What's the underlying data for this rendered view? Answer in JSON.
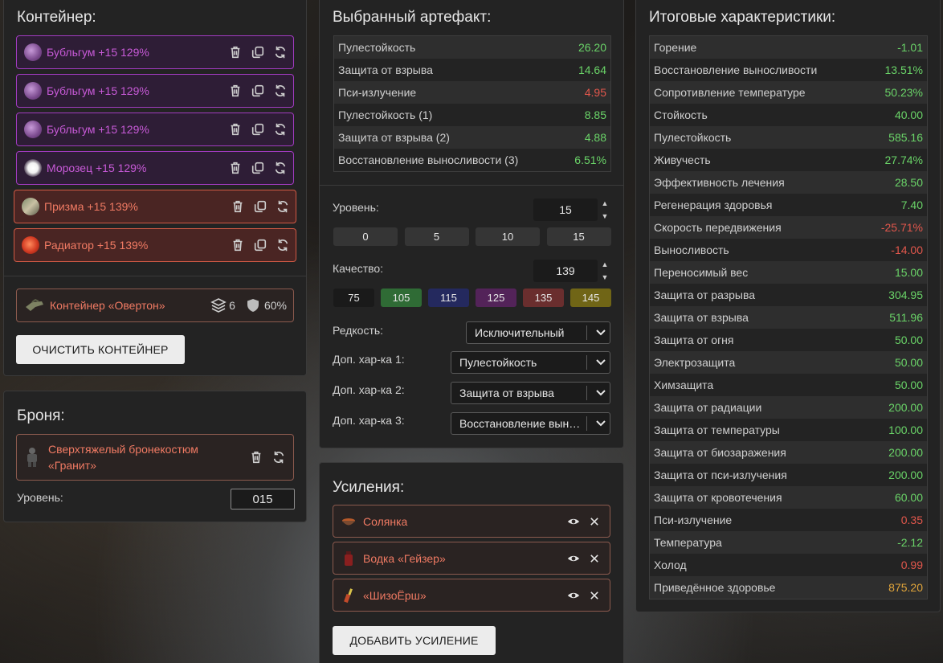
{
  "container_panel": {
    "title": "Контейнер:",
    "items": [
      {
        "name": "Бубльгум +15 129%",
        "tone": "purple",
        "icon": "bubblegum-artifact-icon"
      },
      {
        "name": "Бубльгум +15 129%",
        "tone": "purple",
        "icon": "bubblegum-artifact-icon"
      },
      {
        "name": "Бубльгум +15 129%",
        "tone": "purple",
        "icon": "bubblegum-artifact-icon"
      },
      {
        "name": "Морозец +15 129%",
        "tone": "purple",
        "icon": "frost-artifact-icon"
      },
      {
        "name": "Призма +15 139%",
        "tone": "red",
        "icon": "prism-artifact-icon"
      },
      {
        "name": "Радиатор +15 139%",
        "tone": "red",
        "icon": "radiator-artifact-icon"
      }
    ],
    "container": {
      "name": "Контейнер «Овертон»",
      "slots": "6",
      "protection": "60%"
    },
    "clear_button": "ОЧИСТИТЬ КОНТЕЙНЕР"
  },
  "armor_panel": {
    "title": "Броня:",
    "armor_name_line1": "Сверхтяжелый бронекостюм",
    "armor_name_line2": "«Гранит»",
    "level_label": "Уровень:",
    "level_value": "015"
  },
  "artifact_panel": {
    "title": "Выбранный артефакт:",
    "stats": [
      {
        "label": "Пулестойкость",
        "value": "26.20",
        "tone": "green"
      },
      {
        "label": "Защита от взрыва",
        "value": "14.64",
        "tone": "green"
      },
      {
        "label": "Пси-излучение",
        "value": "4.95",
        "tone": "red"
      },
      {
        "label": "Пулестойкость (1)",
        "value": "8.85",
        "tone": "green"
      },
      {
        "label": "Защита от взрыва (2)",
        "value": "4.88",
        "tone": "green"
      },
      {
        "label": "Восстановление выносливости (3)",
        "value": "6.51%",
        "tone": "green"
      }
    ],
    "level_label": "Уровень:",
    "level_value": "15",
    "level_presets": [
      "0",
      "5",
      "10",
      "15"
    ],
    "quality_label": "Качество:",
    "quality_value": "139",
    "quality_presets": [
      {
        "label": "75",
        "color": "#1a1a1a"
      },
      {
        "label": "105",
        "color": "#2f6b35"
      },
      {
        "label": "115",
        "color": "#24295e"
      },
      {
        "label": "125",
        "color": "#532359"
      },
      {
        "label": "135",
        "color": "#6a2e2e"
      },
      {
        "label": "145",
        "color": "#706516"
      }
    ],
    "rarity_label": "Редкость:",
    "rarity_value": "Исключительный",
    "extra1_label": "Доп. хар-ка 1:",
    "extra1_value": "Пулестойкость",
    "extra2_label": "Доп. хар-ка 2:",
    "extra2_value": "Защита от взрыва",
    "extra3_label": "Доп. хар-ка 3:",
    "extra3_value": "Восстановление выносливости"
  },
  "boosts_panel": {
    "title": "Усиления:",
    "items": [
      {
        "name": "Солянка",
        "icon": "solyanka-bowl-icon"
      },
      {
        "name": "Водка «Гейзер»",
        "icon": "vodka-bottle-icon"
      },
      {
        "name": "«ШизоЁрш»",
        "icon": "cocktail-bottle-icon"
      }
    ],
    "add_button": "ДОБАВИТЬ УСИЛЕНИЕ"
  },
  "totals_panel": {
    "title": "Итоговые характеристики:",
    "stats": [
      {
        "label": "Горение",
        "value": "-1.01",
        "tone": "green"
      },
      {
        "label": "Восстановление выносливости",
        "value": "13.51%",
        "tone": "green"
      },
      {
        "label": "Сопротивление температуре",
        "value": "50.23%",
        "tone": "green"
      },
      {
        "label": "Стойкость",
        "value": "40.00",
        "tone": "green"
      },
      {
        "label": "Пулестойкость",
        "value": "585.16",
        "tone": "green"
      },
      {
        "label": "Живучесть",
        "value": "27.74%",
        "tone": "green"
      },
      {
        "label": "Эффективность лечения",
        "value": "28.50",
        "tone": "green"
      },
      {
        "label": "Регенерация здоровья",
        "value": "7.40",
        "tone": "green"
      },
      {
        "label": "Скорость передвижения",
        "value": "-25.71%",
        "tone": "red"
      },
      {
        "label": "Выносливость",
        "value": "-14.00",
        "tone": "red"
      },
      {
        "label": "Переносимый вес",
        "value": "15.00",
        "tone": "green"
      },
      {
        "label": "Защита от разрыва",
        "value": "304.95",
        "tone": "green"
      },
      {
        "label": "Защита от взрыва",
        "value": "511.96",
        "tone": "green"
      },
      {
        "label": "Защита от огня",
        "value": "50.00",
        "tone": "green"
      },
      {
        "label": "Электрозащита",
        "value": "50.00",
        "tone": "green"
      },
      {
        "label": "Химзащита",
        "value": "50.00",
        "tone": "green"
      },
      {
        "label": "Защита от радиации",
        "value": "200.00",
        "tone": "green"
      },
      {
        "label": "Защита от температуры",
        "value": "100.00",
        "tone": "green"
      },
      {
        "label": "Защита от биозаражения",
        "value": "200.00",
        "tone": "green"
      },
      {
        "label": "Защита от пси-излучения",
        "value": "200.00",
        "tone": "green"
      },
      {
        "label": "Защита от кровотечения",
        "value": "60.00",
        "tone": "green"
      },
      {
        "label": "Пси-излучение",
        "value": "0.35",
        "tone": "red"
      },
      {
        "label": "Температура",
        "value": "-2.12",
        "tone": "green"
      },
      {
        "label": "Холод",
        "value": "0.99",
        "tone": "red"
      },
      {
        "label": "Приведённое здоровье",
        "value": "875.20",
        "tone": "orange"
      }
    ]
  },
  "colors": {
    "green": "#6ad468",
    "red": "#e2574c",
    "orange": "#e1a53a",
    "purple_border": "#a13bc0",
    "red_border": "#d05a45"
  }
}
